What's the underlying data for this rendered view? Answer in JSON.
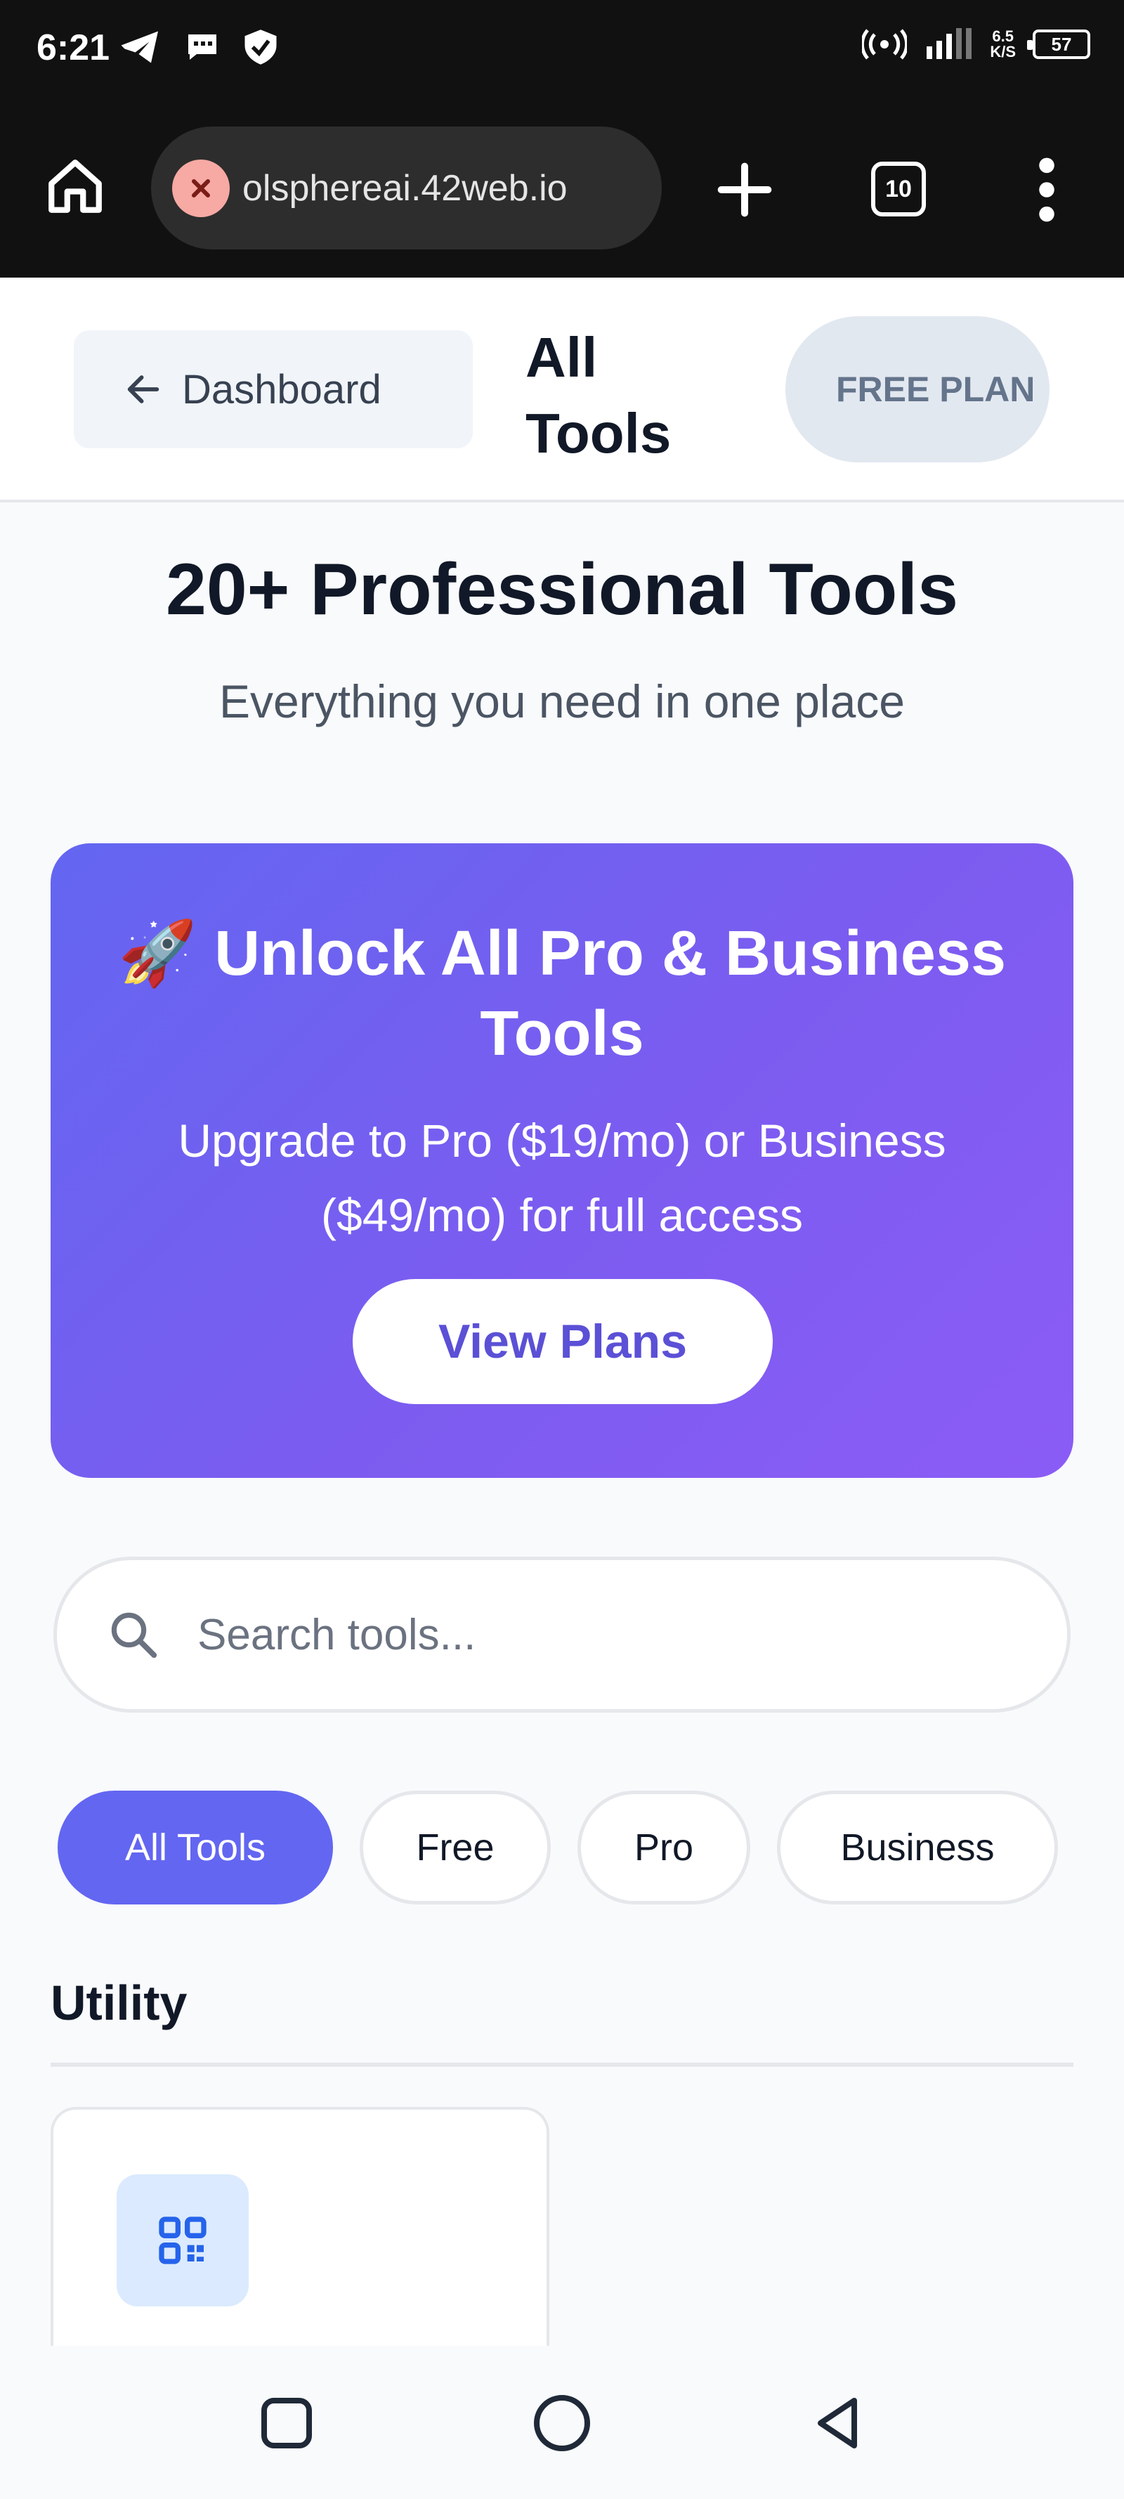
{
  "status_bar": {
    "time": "6:21",
    "net_speed_value": "6.5",
    "net_speed_unit": "K/S",
    "battery": "57"
  },
  "browser": {
    "url": "olsphereai.42web.io",
    "tab_count": "10"
  },
  "header": {
    "back_label": "Dashboard",
    "title": "All Tools",
    "plan_badge": "FREE PLAN"
  },
  "hero": {
    "title": "20+ Professional Tools",
    "subtitle": "Everything you need in one place"
  },
  "promo": {
    "title": "🚀 Unlock All Pro & Business Tools",
    "description": "Upgrade to Pro ($19/mo) or Business ($49/mo) for full access",
    "button": "View Plans"
  },
  "search": {
    "placeholder": "Search tools..."
  },
  "filters": [
    {
      "label": "All Tools",
      "active": true
    },
    {
      "label": "Free",
      "active": false
    },
    {
      "label": "Pro",
      "active": false
    },
    {
      "label": "Business",
      "active": false
    }
  ],
  "section": {
    "title": "Utility"
  },
  "colors": {
    "accent": "#6366f1",
    "promo_gradient_start": "#6366f1",
    "promo_gradient_end": "#8b5cf6",
    "tool_icon_bg": "#dbeafe"
  },
  "icons": {
    "home": "home-icon",
    "url_error": "close-circle-icon",
    "new_tab": "plus-icon",
    "menu": "more-vertical-icon",
    "back": "arrow-left-icon",
    "search": "search-icon",
    "tool": "qr-code-icon"
  }
}
